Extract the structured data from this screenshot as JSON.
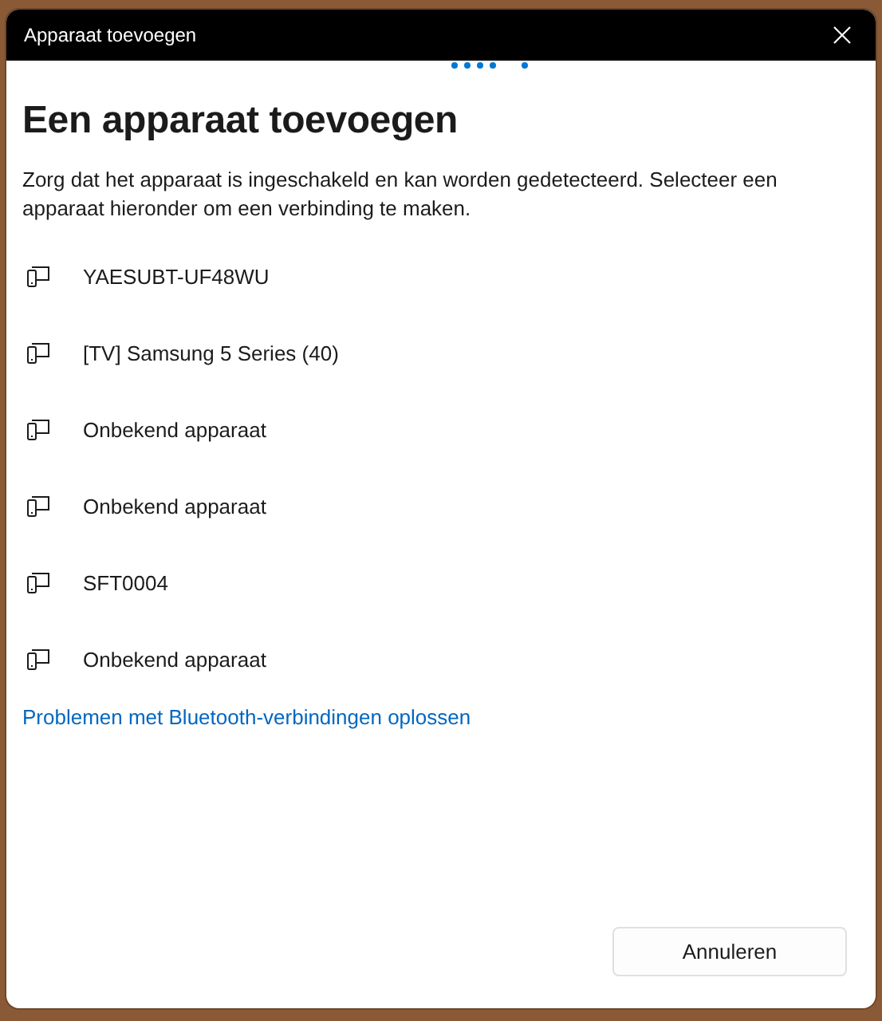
{
  "window": {
    "title": "Apparaat toevoegen"
  },
  "heading": "Een apparaat toevoegen",
  "description": "Zorg dat het apparaat is ingeschakeld en kan worden gedetecteerd. Selecteer een apparaat hieronder om een verbinding te maken.",
  "devices": [
    {
      "name": "YAESUBT-UF48WU"
    },
    {
      "name": "[TV] Samsung 5 Series (40)"
    },
    {
      "name": "Onbekend apparaat"
    },
    {
      "name": "Onbekend apparaat"
    },
    {
      "name": "SFT0004"
    },
    {
      "name": "Onbekend apparaat"
    }
  ],
  "help_link": "Problemen met Bluetooth-verbindingen oplossen",
  "buttons": [
    "Annuleren"
  ]
}
